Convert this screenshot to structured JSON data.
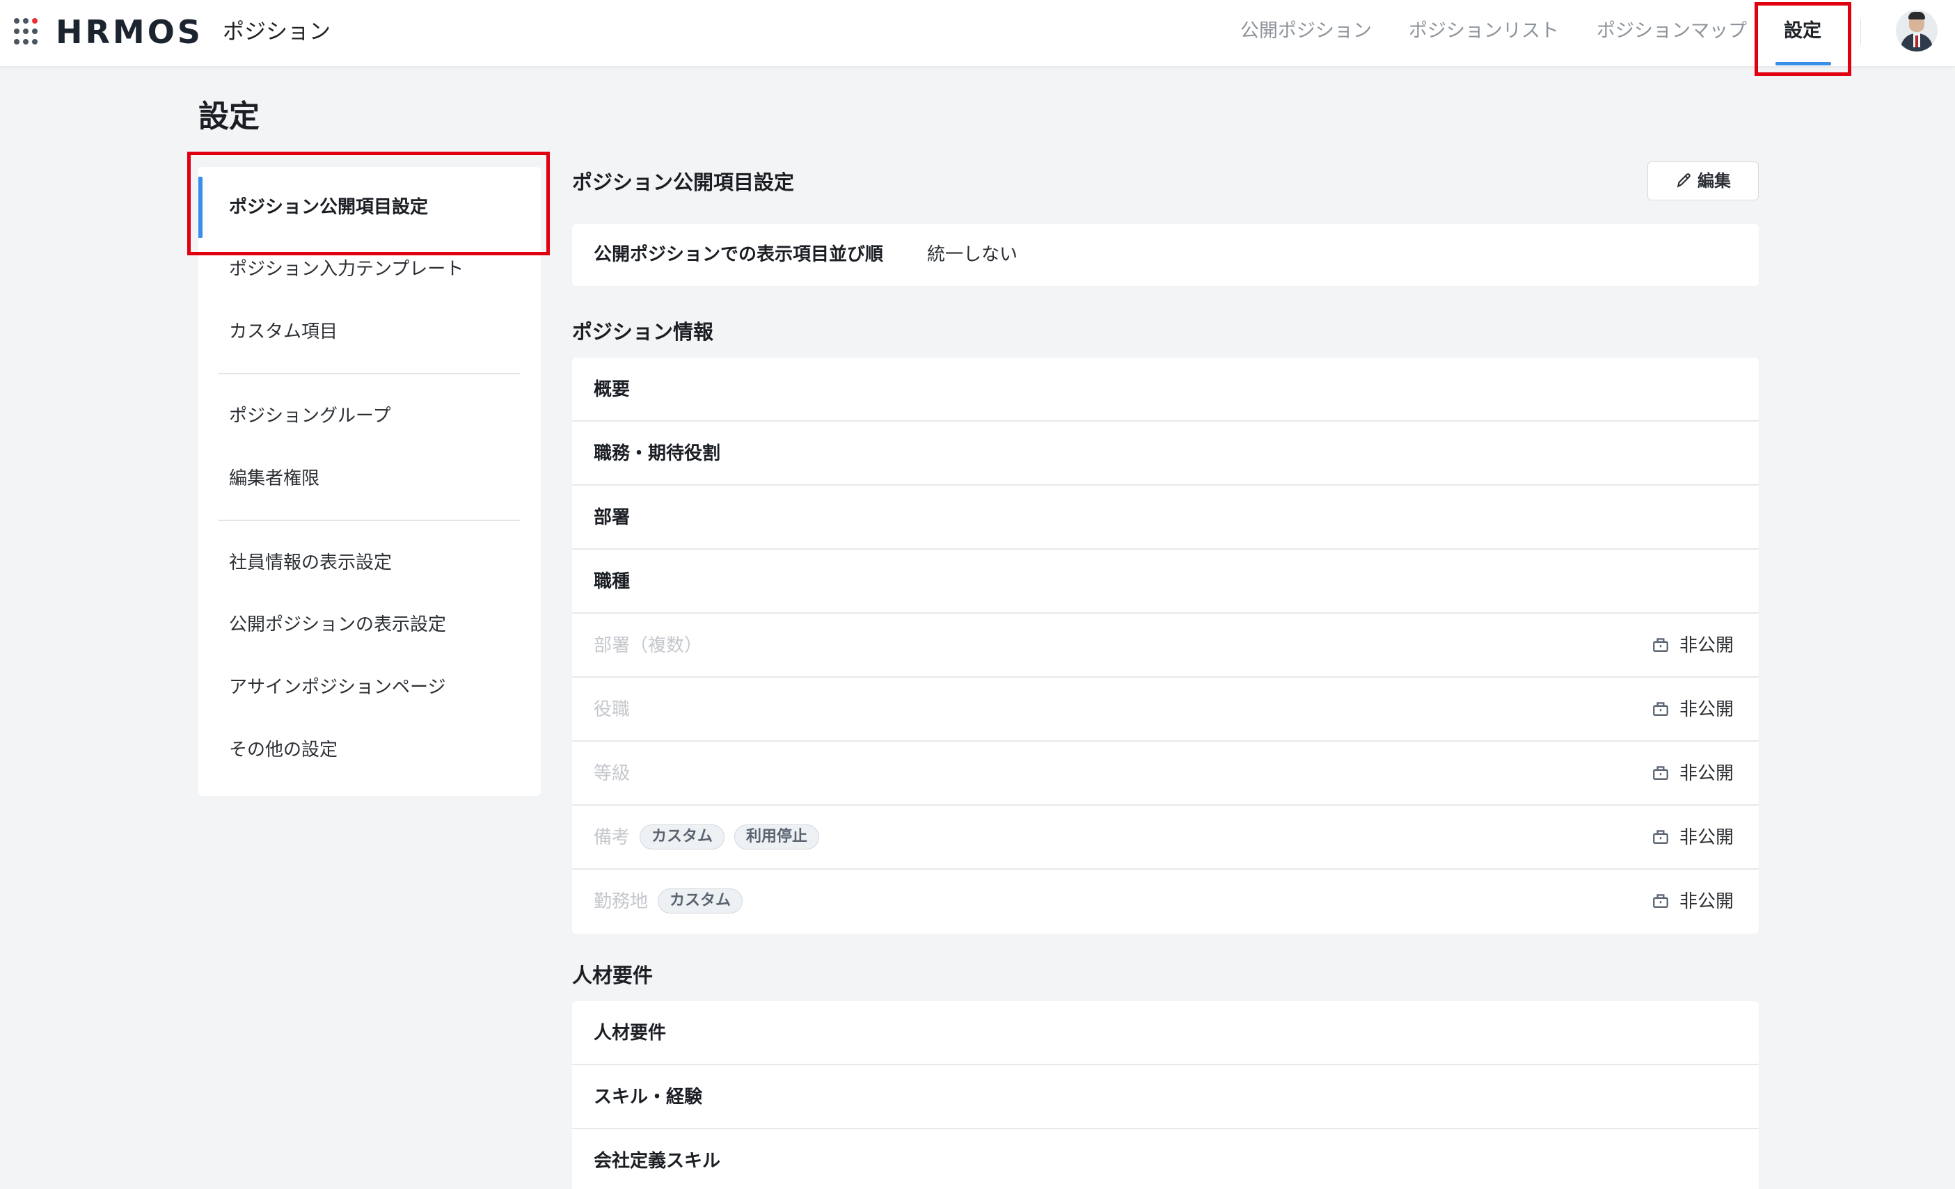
{
  "header": {
    "logo_text": "HRMOS",
    "product_name": "ポジション",
    "nav": [
      {
        "label": "公開ポジション",
        "active": false
      },
      {
        "label": "ポジションリスト",
        "active": false
      },
      {
        "label": "ポジションマップ",
        "active": false
      },
      {
        "label": "設定",
        "active": true
      }
    ],
    "avatar_icon": "user-avatar"
  },
  "page": {
    "title": "設定"
  },
  "side_menu": {
    "items": [
      {
        "label": "ポジション公開項目設定",
        "active": true
      },
      {
        "label": "ポジション入力テンプレート",
        "active": false
      },
      {
        "label": "カスタム項目",
        "active": false
      },
      {
        "label": "ポジショングループ",
        "active": false
      },
      {
        "label": "編集者権限",
        "active": false
      },
      {
        "label": "社員情報の表示設定",
        "active": false
      },
      {
        "label": "公開ポジションの表示設定",
        "active": false
      },
      {
        "label": "アサインポジションページ",
        "active": false
      },
      {
        "label": "その他の設定",
        "active": false
      }
    ]
  },
  "main": {
    "title": "ポジション公開項目設定",
    "edit_label": "編集",
    "order_setting": {
      "label": "公開ポジションでの表示項目並び順",
      "value": "統一しない"
    },
    "sections": [
      {
        "title": "ポジション情報",
        "rows": [
          {
            "label": "概要",
            "tags": [],
            "status": ""
          },
          {
            "label": "職務・期待役割",
            "tags": [],
            "status": ""
          },
          {
            "label": "部署",
            "tags": [],
            "status": ""
          },
          {
            "label": "職種",
            "tags": [],
            "status": ""
          },
          {
            "label": "部署（複数）",
            "tags": [],
            "status": "非公開"
          },
          {
            "label": "役職",
            "tags": [],
            "status": "非公開"
          },
          {
            "label": "等級",
            "tags": [],
            "status": "非公開"
          },
          {
            "label": "備考",
            "tags": [
              "カスタム",
              "利用停止"
            ],
            "status": "非公開"
          },
          {
            "label": "勤務地",
            "tags": [
              "カスタム"
            ],
            "status": "非公開"
          }
        ]
      },
      {
        "title": "人材要件",
        "rows": [
          {
            "label": "人材要件",
            "tags": [],
            "status": ""
          },
          {
            "label": "スキル・経験",
            "tags": [],
            "status": ""
          },
          {
            "label": "会社定義スキル",
            "tags": [],
            "status": ""
          }
        ]
      }
    ]
  },
  "colors": {
    "accent": "#3b8ee8",
    "highlight": "#e00010",
    "background": "#f3f4f5"
  }
}
